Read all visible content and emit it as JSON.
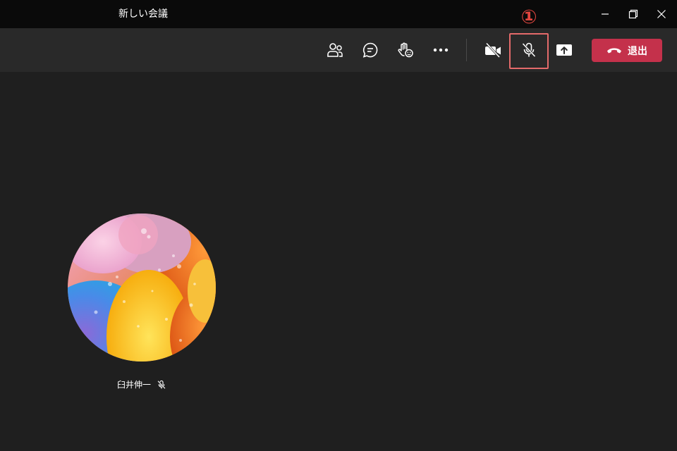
{
  "window": {
    "title": "新しい会議",
    "controls": [
      "minimize-icon",
      "restore-icon",
      "close-icon"
    ]
  },
  "toolbar": {
    "buttons": [
      {
        "name": "participants",
        "icon": "people-icon"
      },
      {
        "name": "chat",
        "icon": "chat-icon"
      },
      {
        "name": "reactions",
        "icon": "raise-hand-icon"
      },
      {
        "name": "more",
        "icon": "more-icon"
      },
      {
        "name": "camera",
        "icon": "camera-off-icon"
      },
      {
        "name": "mic",
        "icon": "mic-off-icon"
      },
      {
        "name": "share",
        "icon": "share-screen-icon"
      }
    ],
    "leave_label": "退出"
  },
  "annotation": {
    "callout": "①",
    "color": "#e2463f"
  },
  "participant": {
    "name": "臼井伸一",
    "muted": true
  },
  "colors": {
    "titlebar": "#0a0a0a",
    "toolbar": "#292929",
    "stage": "#1f1f1f",
    "leave": "#c4314b"
  }
}
